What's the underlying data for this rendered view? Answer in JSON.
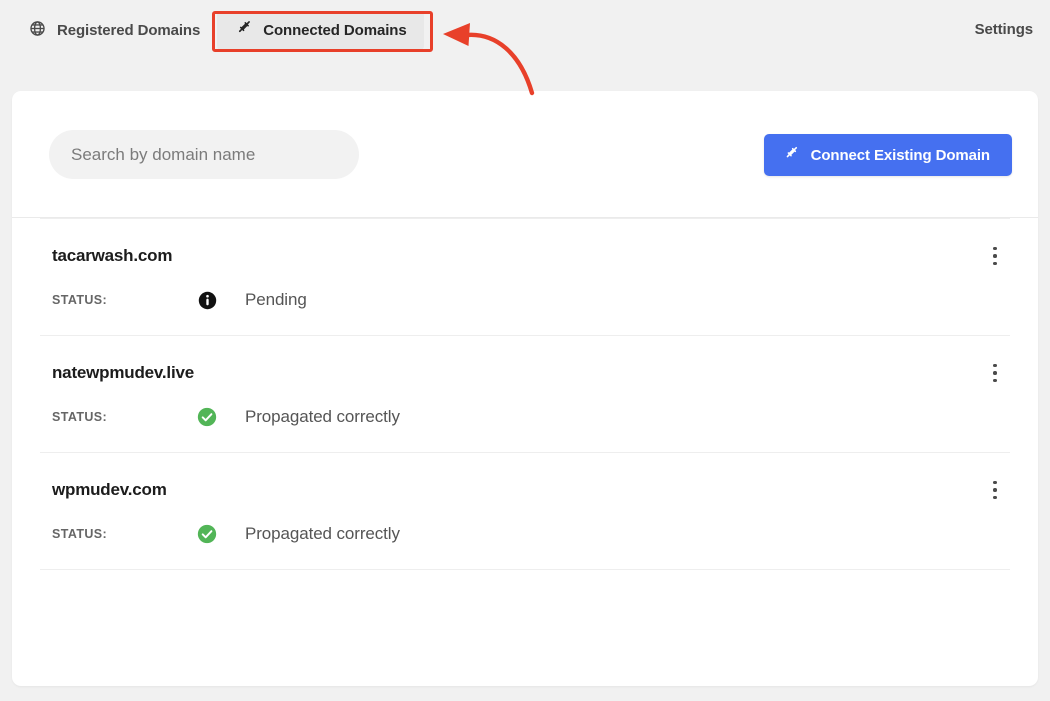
{
  "topbar": {
    "tabs": [
      {
        "id": "registered-domains",
        "label": "Registered Domains",
        "icon": "globe-icon",
        "active": false
      },
      {
        "id": "connected-domains",
        "label": "Connected Domains",
        "icon": "plug-icon",
        "active": true
      }
    ],
    "settings_label": "Settings"
  },
  "annotation": {
    "type": "curved-arrow",
    "color": "#e8402a",
    "points_to": "connected-domains-tab"
  },
  "card": {
    "search": {
      "placeholder": "Search by domain name",
      "value": ""
    },
    "connect_button": {
      "label": "Connect Existing Domain",
      "icon": "plug-icon",
      "color": "#4570f0"
    },
    "status_label": "STATUS:",
    "domains": [
      {
        "name": "tacarwash.com",
        "status": "Pending",
        "status_icon": "info-circle-icon",
        "status_color": "#111111",
        "menu_icon": "more-vertical-icon"
      },
      {
        "name": "natewpmudev.live",
        "status": "Propagated correctly",
        "status_icon": "check-circle-icon",
        "status_color": "#52b557",
        "menu_icon": "more-vertical-icon"
      },
      {
        "name": "wpmudev.com",
        "status": "Propagated correctly",
        "status_icon": "check-circle-icon",
        "status_color": "#52b557",
        "menu_icon": "more-vertical-icon"
      }
    ]
  }
}
